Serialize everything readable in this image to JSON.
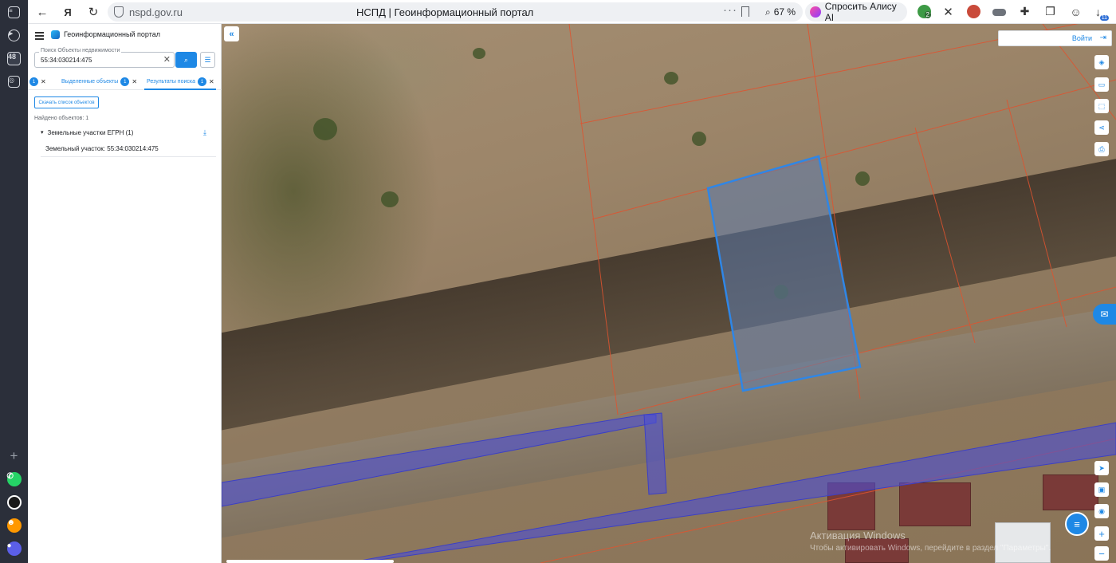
{
  "browser": {
    "url": "nspd.gov.ru",
    "page_title": "НСПД | Геоинформационный портал",
    "zoom": "67 %",
    "alice_label": "Спросить Алису AI",
    "rail_tab_count": "48",
    "ext_badge_1": "2",
    "downloads_badge": "11"
  },
  "panel": {
    "brand": "Геоинформационный портал",
    "search": {
      "label": "Поиск Объекты недвижимости",
      "value": "55:34:030214:475"
    },
    "tabs": {
      "left_badge": "1",
      "selected_label": "Выделенные объекты",
      "selected_count": "1",
      "results_label": "Результаты поиска",
      "results_count": "1"
    },
    "download_button": "Скачать список объектов",
    "found_text": "Найдено объектов: 1",
    "group_label": "Земельные участки ЕГРН (1)",
    "result_item": "Земельный участок: 55:34:030214:475"
  },
  "map": {
    "login_label": "Войти",
    "watermark_line1": "Активация Windows",
    "watermark_line2": "Чтобы активировать Windows, перейдите в раздел \"Параметры\".",
    "colors": {
      "parcel_stroke": "#2f86e6",
      "parcel_fill": "#5f7cab",
      "boundary": "#e0532f",
      "zone": "#4b4fd6"
    }
  }
}
